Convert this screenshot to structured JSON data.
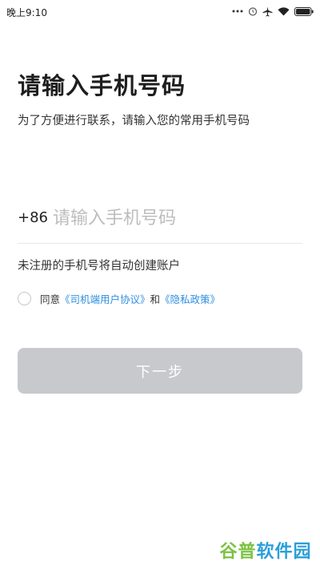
{
  "status_bar": {
    "time": "晚上9:10"
  },
  "title": "请输入手机号码",
  "subtitle": "为了方便进行联系，请输入您的常用手机号码",
  "phone": {
    "country_code": "+86",
    "placeholder": "请输入手机号码",
    "value": ""
  },
  "notice": "未注册的手机号将自动创建账户",
  "agreement": {
    "prefix": "同意",
    "link1": "《司机端用户协议》",
    "conjunction": "和",
    "link2": "《隐私政策》",
    "checked": false
  },
  "next_button": {
    "label": "下一步",
    "enabled": false
  },
  "watermark": {
    "part1": "谷普",
    "part2": "软件园"
  },
  "colors": {
    "link": "#2f8fe0",
    "button_disabled": "#c8c9cc"
  },
  "icons": [
    "dots-icon",
    "alarm-icon",
    "airplane-icon",
    "wifi-icon",
    "battery-icon"
  ]
}
